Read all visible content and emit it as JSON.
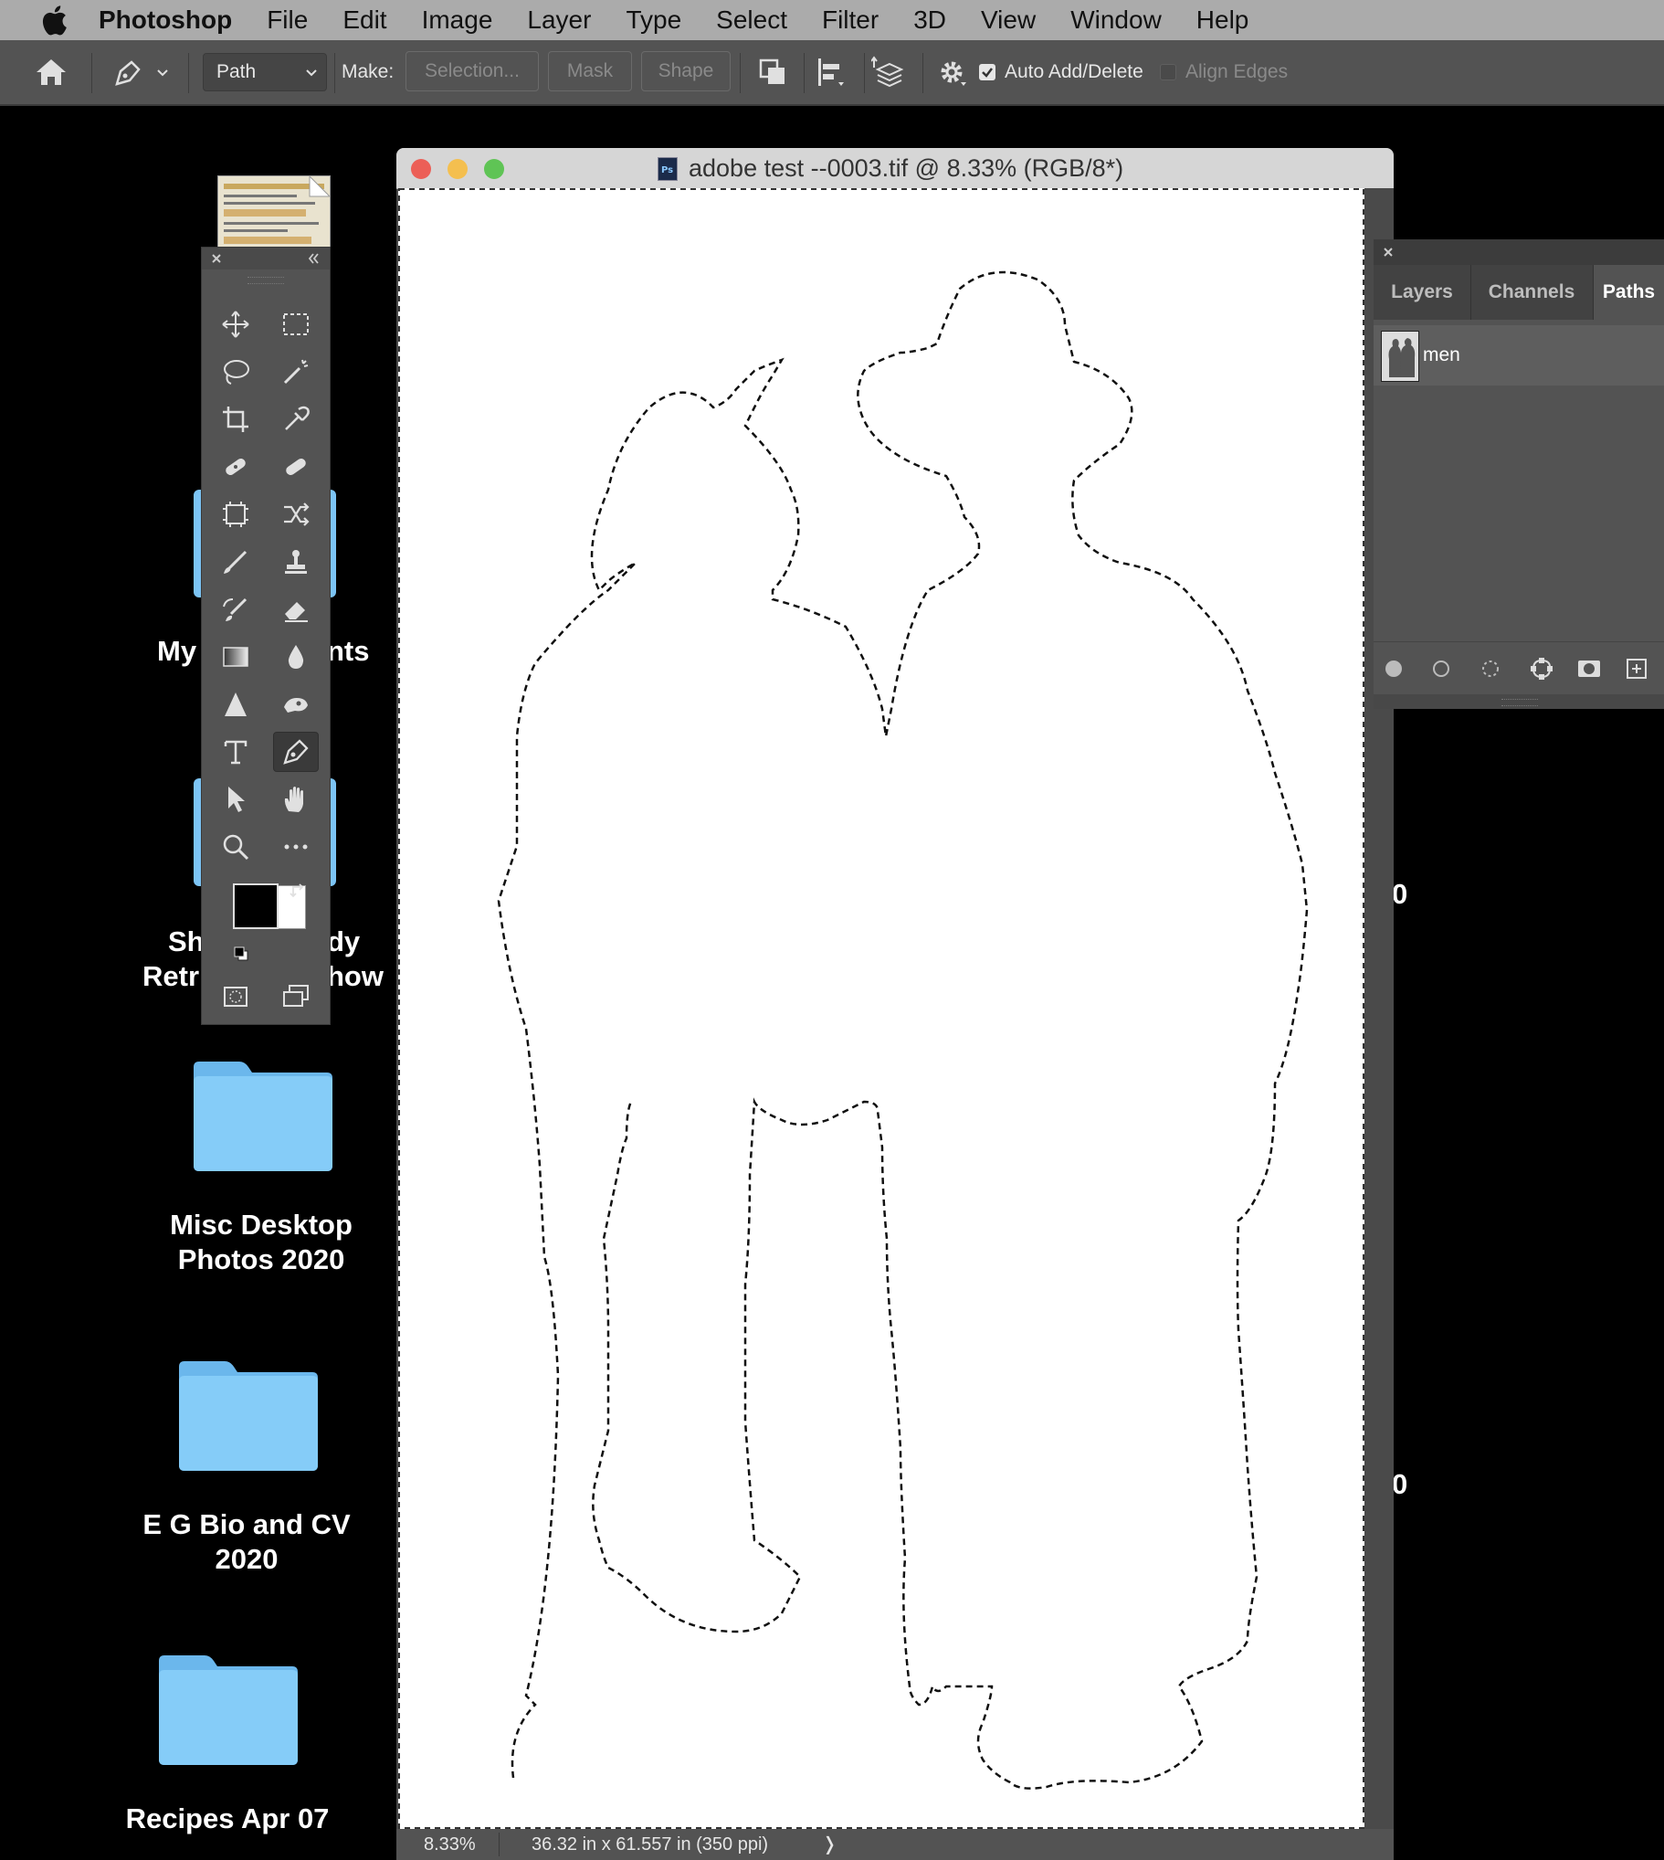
{
  "menubar": {
    "app_name": "Photoshop",
    "items": [
      "File",
      "Edit",
      "Image",
      "Layer",
      "Type",
      "Select",
      "Filter",
      "3D",
      "View",
      "Window",
      "Help"
    ]
  },
  "options": {
    "mode_select": "Path",
    "make_label": "Make:",
    "selection_button": "Selection...",
    "mask_button": "Mask",
    "shape_button": "Shape",
    "auto_add_delete_label": "Auto Add/Delete",
    "auto_add_delete_checked": true,
    "align_edges_label": "Align Edges",
    "align_edges_checked": false
  },
  "desktop": {
    "partial_labels": {
      "my_left": "My",
      "my_right": "nts",
      "sh_left": "Sh",
      "sh_right": "dy",
      "retr_left": "Retr",
      "retr_right": "how"
    },
    "folders": [
      {
        "line1": "Misc Desktop",
        "line2": "Photos 2020"
      },
      {
        "line1": "E G Bio and CV",
        "line2": "2020"
      },
      {
        "line1": "Recipes Apr 07",
        "line2": ""
      }
    ],
    "right_edge_chars": [
      "0",
      "0"
    ]
  },
  "document": {
    "title": "adobe test --0003.tif @ 8.33% (RGB/8*)",
    "zoom": "8.33%",
    "doc_info": "36.32 in x 61.557 in (350 ppi)",
    "status_arrow": "❭"
  },
  "panel": {
    "tabs": [
      "Layers",
      "Channels",
      "Paths"
    ],
    "active_tab": "Paths",
    "paths": [
      {
        "name": "men"
      }
    ]
  },
  "colors": {
    "foreground": "#000000",
    "background": "#ffffff",
    "ui_panel": "#535353",
    "folder_blue": "#7cc4f5"
  }
}
